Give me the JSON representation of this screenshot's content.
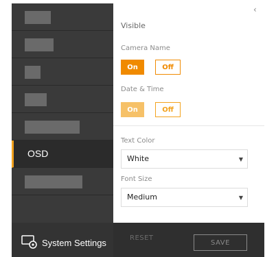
{
  "sidebar": {
    "items": [
      {
        "label": "",
        "placeholder": true
      },
      {
        "label": "",
        "placeholder": true
      },
      {
        "label": "",
        "placeholder": true
      },
      {
        "label": "",
        "placeholder": true
      },
      {
        "label": "",
        "placeholder": true
      },
      {
        "label": "OSD",
        "active": true
      },
      {
        "label": "",
        "placeholder": true
      }
    ],
    "footer_label": "System Settings",
    "footer_icon": "settings-gear-icon"
  },
  "panel": {
    "section_title": "Visible",
    "camera_name": {
      "label": "Camera Name",
      "on": "On",
      "off": "Off",
      "selected": "On"
    },
    "date_time": {
      "label": "Date & Time",
      "on": "On",
      "off": "Off",
      "selected": "On"
    },
    "text_color": {
      "label": "Text Color",
      "value": "White"
    },
    "font_size": {
      "label": "Font Size",
      "value": "Medium"
    }
  },
  "actions": {
    "reset_label": "RESET",
    "save_label": "SAVE"
  },
  "colors": {
    "accent": "#f08a00",
    "sidebar_bg": "#3a3a3a",
    "frame_bg": "#2f2f2f"
  }
}
